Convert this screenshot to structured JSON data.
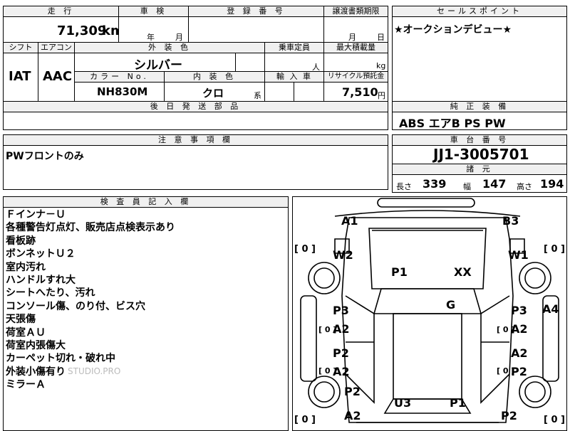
{
  "sheet": {
    "mileage_header": "走 行",
    "mileage": "71,309",
    "mileage_unit": "km",
    "inspection_header": "車 検",
    "inspection_year": "年",
    "inspection_month": "月",
    "registration_header": "登 録 番 号",
    "transfer_header": "譲渡書類期限",
    "transfer_month": "月",
    "transfer_day": "日",
    "shift_header": "シフト",
    "shift": "IAT",
    "ac_header": "エアコン",
    "ac": "AAC",
    "exterior_header": "外 装 色",
    "exterior_color": "シルバー",
    "capacity_header": "乗車定員",
    "capacity_unit": "人",
    "load_header": "最大積載量",
    "load_unit": "kg",
    "color_no_header": "カラー No.",
    "color_no": "NH830M",
    "interior_header": "内 装 色",
    "interior_color": "クロ",
    "interior_suffix": "系",
    "import_header": "輸 入 車",
    "recycle_header": "リサイクル預託金",
    "recycle_fee": "7,510",
    "recycle_unit": "円",
    "later_parts_header": "後 日 発 送 部 品"
  },
  "selling_points": {
    "header": "セールスポイント",
    "text": "★オークションデビュー★"
  },
  "genuine": {
    "header": "純 正 装 備",
    "text": "ABS エアB PS PW"
  },
  "caution": {
    "header": "注 意 事 項 欄",
    "text": "PWフロントのみ"
  },
  "chassis": {
    "header": "車 台 番 号",
    "number": "JJ1-3005701",
    "specs_header": "諸 元",
    "length_label": "長さ",
    "length": "339",
    "width_label": "幅",
    "width": "147",
    "height_label": "高さ",
    "height": "194"
  },
  "inspector": {
    "header": "検 査 員 記 入 欄",
    "lines": [
      "Ｆインナ－Ｕ",
      "各種警告灯点灯、販売店点検表示あり",
      "看板跡",
      "ボンネットＵ２",
      "室内汚れ",
      "ハンドルすれ大",
      "シートへたり、汚れ",
      "コンソール傷、のり付、ビス穴",
      "天張傷",
      "荷室ＡＵ",
      "荷室内張傷大",
      "カーペット切れ・破れ中",
      "外装小傷有り",
      "ミラーＡ"
    ],
    "watermark": "STUDIO.PRO"
  },
  "diagram": {
    "left_bracket": "[ 0 ]",
    "right_bracket": "[ 0 ]",
    "bl_bracket": "[ 0 ]",
    "br_bracket": "[ 0 ]",
    "lmid_bracket": "[ 0 ]",
    "rmid_bracket": "[ 0 ]",
    "lmid2_bracket": "[ 0 ]",
    "rmid2_bracket": "[ 0 ]",
    "marks": {
      "a1": "A1",
      "b3": "B3",
      "w2": "W2",
      "w1": "W1",
      "p1_hood": "P1",
      "xx": "XX",
      "g": "G",
      "p3_l": "P3",
      "a2_l1": "A2",
      "p3_r": "P3",
      "a2_r1": "A2",
      "a4": "A4",
      "p2_l": "P2",
      "a2_l2": "A2",
      "a2_r2": "A2",
      "p2_r": "P2",
      "p2_bl": "P2",
      "a2_bl": "A2",
      "u3": "U3",
      "p1_rear": "P1",
      "p2_br": "P2"
    }
  }
}
